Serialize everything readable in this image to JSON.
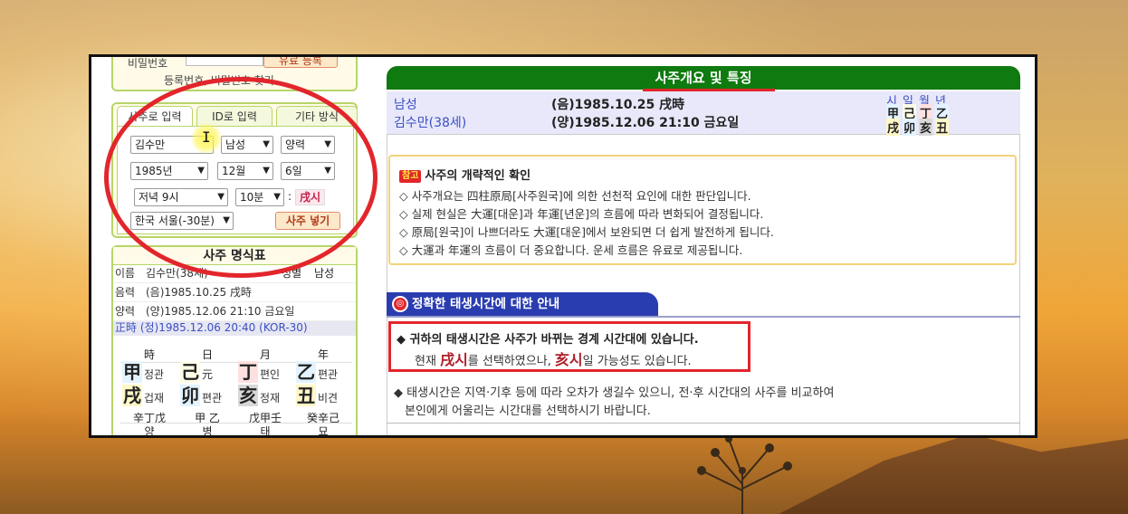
{
  "login": {
    "password_label": "비밀번호",
    "paid_register_btn": "유료 등록",
    "find_links": "등록번호, 비밀번호 찾기"
  },
  "tabs": [
    {
      "label": "사주로 입력"
    },
    {
      "label": "ID로 입력"
    },
    {
      "label": "기타 방식"
    }
  ],
  "form": {
    "name": "김수만",
    "gender": "남성",
    "calendar": "양력",
    "year": "1985년",
    "month": "12월",
    "day": "6일",
    "hour": "저녁 9시",
    "minute": "10분",
    "colon": ":",
    "ganji_hour": "戌시",
    "region": "한국 서울(-30분)",
    "submit": "사주 넣기"
  },
  "saju_table": {
    "title": "사주 명식표",
    "name_label": "이름",
    "name_value": "김수만(38세)",
    "gender_label": "성별",
    "gender_value": "남성",
    "lunar_label": "음력",
    "lunar_value": "(음)1985.10.25 戌時",
    "solar_label": "양력",
    "solar_value": "(양)1985.12.06 21:10 금요일",
    "correct_time": "正時 (정)1985.12.06 20:40 (KOR-30)",
    "headers": [
      "時",
      "日",
      "月",
      "年"
    ],
    "stems": [
      {
        "char": "甲",
        "label": "정관",
        "color": "#e3f3ff"
      },
      {
        "char": "己",
        "label": "元",
        "color": "#fffde6"
      },
      {
        "char": "丁",
        "label": "편인",
        "color": "#ffe0e0"
      },
      {
        "char": "乙",
        "label": "편관",
        "color": "#e3f3ff"
      }
    ],
    "branches": [
      {
        "char": "戌",
        "label": "겁재",
        "color": "#fff7c8"
      },
      {
        "char": "卯",
        "label": "편관",
        "color": "#e3f3ff"
      },
      {
        "char": "亥",
        "label": "정재",
        "color": "#d8d8d8"
      },
      {
        "char": "丑",
        "label": "비견",
        "color": "#fff7c8"
      }
    ],
    "hidden": [
      "辛丁戊",
      "甲 乙",
      "戊甲壬",
      "癸辛己"
    ],
    "footer": [
      "양",
      "병",
      "태",
      "묘"
    ]
  },
  "header": {
    "title": "사주개요 및 특징"
  },
  "summary": {
    "gender": "남성",
    "name": "김수만(38세)",
    "lunar": "(음)1985.10.25 戌時",
    "solar": "(양)1985.12.06 21:10 금요일",
    "mini_heads": [
      "시",
      "일",
      "월",
      "년"
    ],
    "mini_stems": [
      "甲",
      "己",
      "丁",
      "乙"
    ],
    "mini_branches": [
      "戌",
      "卯",
      "亥",
      "丑"
    ]
  },
  "note": {
    "badge": "참고",
    "title": "사주의 개략적인 확인",
    "lines": [
      "◇ 사주개요는 四柱原局[사주원국]에 의한 선천적 요인에 대한 판단입니다.",
      "◇ 실제 현실은 大運[대운]과 年運[년운]의 흐름에 따라 변화되어 결정됩니다.",
      "◇ 原局[원국]이 나쁘더라도 大運[대운]에서 보완되면 더 쉽게 발전하게 됩니다.",
      "◇ 大運과 年運의 흐름이 더 중요합니다. 운세 흐름은 유료로 제공됩니다."
    ]
  },
  "section": {
    "icon": "◎",
    "title": "정확한 태생시간에 대한 안내"
  },
  "alert": {
    "line1": "◆ 귀하의 태생시간은 사주가 바뀌는 경계 시간대에 있습니다.",
    "line2_a": "현재 ",
    "line2_hl1": "戌시",
    "line2_b": "를 선택하였으나, ",
    "line2_hl2": "亥시",
    "line2_c": "일 가능성도 있습니다."
  },
  "desc": {
    "line1": "◆ 태생시간은 지역·기후 등에 따라 오차가 생길수 있으니, 전·후 시간대의 사주를 비교하여",
    "line2": "본인에게 어울리는 시간대를 선택하시기 바랍니다."
  }
}
